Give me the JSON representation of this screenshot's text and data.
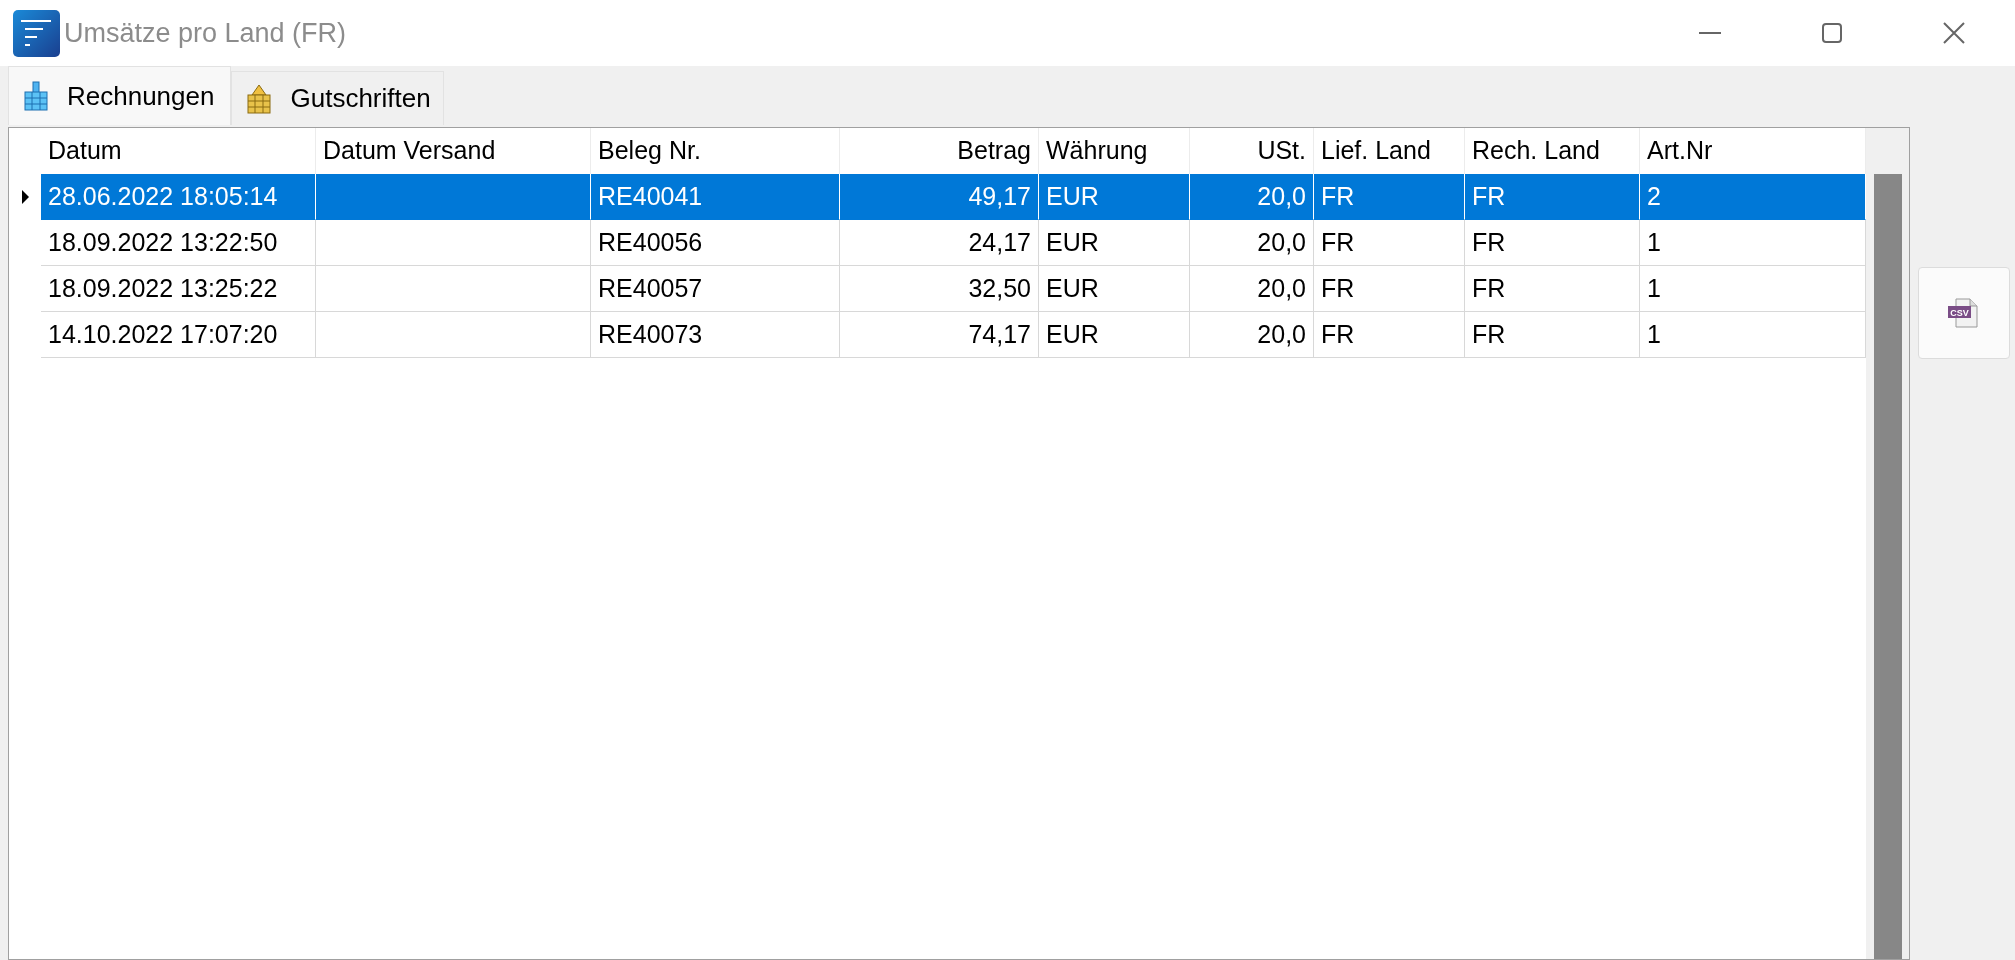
{
  "window": {
    "title": "Umsätze pro Land (FR)"
  },
  "tabs": [
    {
      "label": "Rechnungen",
      "selected": true,
      "kind": "invoice"
    },
    {
      "label": "Gutschriften",
      "selected": false,
      "kind": "credit"
    }
  ],
  "table": {
    "columns": [
      {
        "label": "Datum",
        "kind": "text"
      },
      {
        "label": "Datum Versand",
        "kind": "text"
      },
      {
        "label": "Beleg Nr.",
        "kind": "text"
      },
      {
        "label": "Betrag",
        "kind": "number"
      },
      {
        "label": "Währung",
        "kind": "text"
      },
      {
        "label": "USt.",
        "kind": "number"
      },
      {
        "label": "Lief. Land",
        "kind": "text"
      },
      {
        "label": "Rech. Land",
        "kind": "text"
      },
      {
        "label": "Art.Nr",
        "kind": "text"
      }
    ],
    "rows": [
      {
        "selected": true,
        "cells": [
          "28.06.2022 18:05:14",
          "",
          "RE40041",
          "49,17",
          "EUR",
          "20,0",
          "FR",
          "FR",
          "2"
        ]
      },
      {
        "selected": false,
        "cells": [
          "18.09.2022 13:22:50",
          "",
          "RE40056",
          "24,17",
          "EUR",
          "20,0",
          "FR",
          "FR",
          "1"
        ]
      },
      {
        "selected": false,
        "cells": [
          "18.09.2022 13:25:22",
          "",
          "RE40057",
          "32,50",
          "EUR",
          "20,0",
          "FR",
          "FR",
          "1"
        ]
      },
      {
        "selected": false,
        "cells": [
          "14.10.2022 17:07:20",
          "",
          "RE40073",
          "74,17",
          "EUR",
          "20,0",
          "FR",
          "FR",
          "1"
        ]
      }
    ]
  },
  "side_buttons": [
    {
      "kind": "csv-export",
      "label": "CSV"
    }
  ]
}
